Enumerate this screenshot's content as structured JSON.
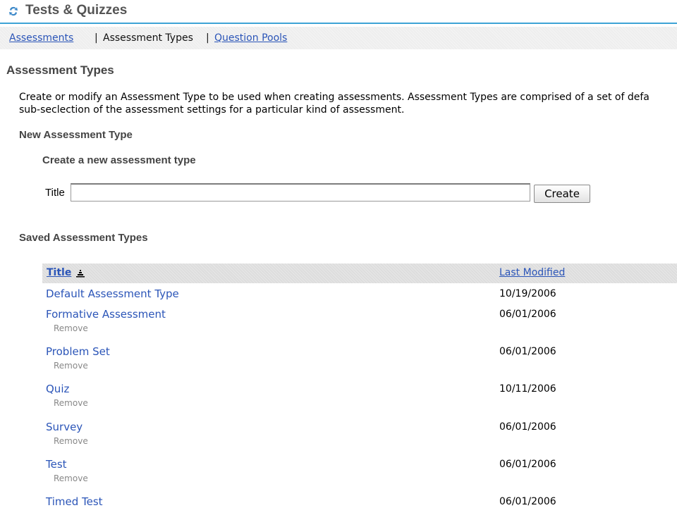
{
  "tool": {
    "title": "Tests & Quizzes",
    "icon": "tests-quizzes-icon",
    "accent": "#3ea3d5"
  },
  "nav": {
    "assessments": "Assessments",
    "sep1": "|",
    "current": "Assessment Types",
    "sep2": "|",
    "question_pools": "Question Pools"
  },
  "page": {
    "title": "Assessment Types",
    "intro_line1": "Create or modify an Assessment Type to be used when creating assessments. Assessment Types are comprised of a set of defa",
    "intro_line2": "sub-seclection of the assessment settings for a particular kind of assessment."
  },
  "new_type": {
    "heading": "New Assessment Type",
    "subheading": "Create a new assessment type",
    "title_label": "Title",
    "title_value": "",
    "create_label": "Create"
  },
  "saved": {
    "heading": "Saved Assessment Types",
    "col_title": "Title",
    "col_modified": "Last Modified",
    "sort_icon": "sort-ascending-icon",
    "rows": [
      {
        "title": "Default Assessment Type",
        "remove": "",
        "date": "10/19/2006"
      },
      {
        "title": "Formative Assessment",
        "remove": "Remove",
        "date": "06/01/2006"
      },
      {
        "title": "Problem Set",
        "remove": "Remove",
        "date": "06/01/2006"
      },
      {
        "title": "Quiz",
        "remove": "Remove",
        "date": "10/11/2006"
      },
      {
        "title": "Survey",
        "remove": "Remove",
        "date": "06/01/2006"
      },
      {
        "title": "Test",
        "remove": "Remove",
        "date": "06/01/2006"
      },
      {
        "title": "Timed Test",
        "remove": "",
        "date": "06/01/2006"
      }
    ]
  },
  "colors": {
    "link": "#2b55b8",
    "heading": "#444444"
  }
}
